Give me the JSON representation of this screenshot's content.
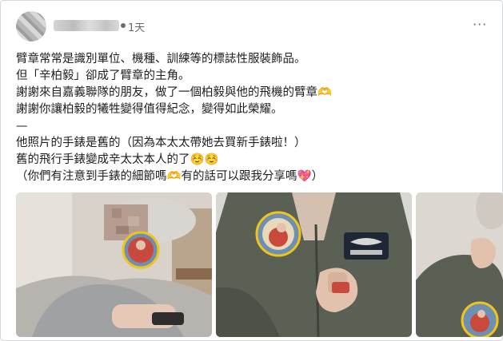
{
  "post": {
    "time": "1天",
    "more_label": "···",
    "lines": [
      "臂章常常是識別單位、機種、訓練等的標誌性服裝飾品。",
      "但「辛柏毅」卻成了臂章的主角。",
      "謝謝來自嘉義聯隊的朋友，做了一個柏毅與他的飛機的臂章🫶",
      "謝謝你讓柏毅的犧牲變得值得紀念，變得如此榮耀。",
      "—",
      "他照片的手錶是舊的（因為本太太帶她去買新手錶啦！）",
      "舊的飛行手錶變成辛太太本人的了☺️☺️",
      "（你們有注意到手錶的細節嗎🫶有的話可以跟我分享嗎💖）"
    ]
  },
  "photos": {
    "count": 3
  },
  "colors": {
    "text": "#1c1e21",
    "muted": "#65676b",
    "jacket_green": "#575c52",
    "patch_gold": "#f0c419"
  }
}
